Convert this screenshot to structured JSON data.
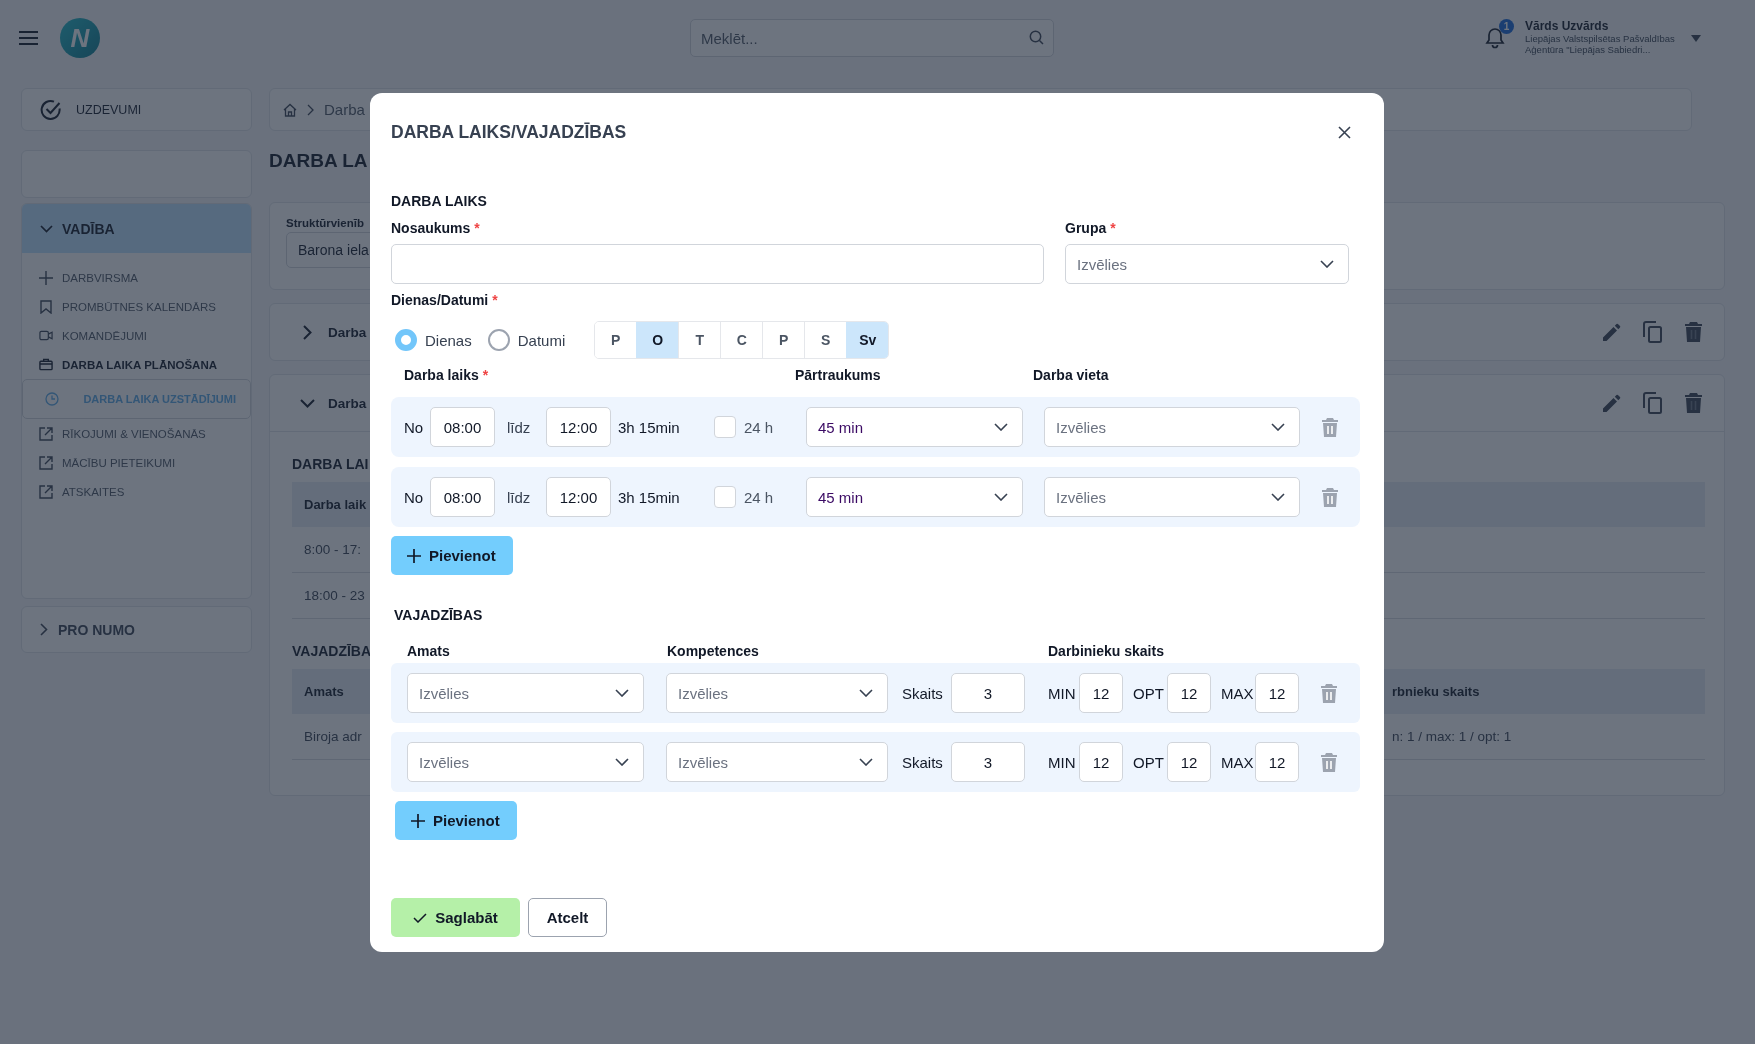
{
  "topbar": {
    "logo": "N",
    "search": {
      "placeholder": "Meklēt..."
    },
    "notifications": {
      "badge": "1"
    },
    "user": {
      "name": "Vārds Uzvārds",
      "org_lines": [
        "Liepājas Valstspilsētas Pašvaldības",
        "Aģentūra \"Liepājas Sabiedri..."
      ]
    }
  },
  "sidebar": {
    "tasks": "UZDEVUMI",
    "section": {
      "title": "VADĪBA",
      "expanded": true,
      "items": [
        {
          "label": "DARBVIRSMA",
          "selected": false,
          "expanded": false
        },
        {
          "label": "PROMBŪTNES KALENDĀRS",
          "selected": false,
          "expanded": false
        },
        {
          "label": "KOMANDĒJUMI",
          "selected": false,
          "expanded": false
        },
        {
          "label": "DARBA LAIKA PLĀNOŠANA",
          "selected": false,
          "expanded": true,
          "children": [
            {
              "label": "DARBA LAIKA UZSTĀDĪJUMI",
              "selected": true
            }
          ]
        },
        {
          "label": "RĪKOJUMI & VIENOŠANĀS",
          "selected": false,
          "expanded": false
        },
        {
          "label": "MĀCĪBU PIETEIKUMI",
          "selected": false,
          "expanded": false
        },
        {
          "label": "ATSKAITES",
          "selected": false,
          "expanded": false
        }
      ]
    },
    "footer_section": {
      "title": "PRO NUMO",
      "expanded": false
    }
  },
  "page": {
    "breadcrumb": "Darba",
    "title": "DARBA LA",
    "filter": {
      "label": "Struktūrvienīb",
      "value": "Barona iela"
    },
    "accordions": [
      {
        "title": "Darba",
        "expanded": false
      },
      {
        "title": "Darba",
        "expanded": true,
        "work_heading": "DARBA LAI",
        "work_column": "Darba laik",
        "work_rows": [
          "8:00 - 17:",
          "18:00 - 23"
        ],
        "needs_heading": "VAJADZĪBA",
        "needs_columns": [
          "Amats",
          "rbnieku skaits"
        ],
        "needs_rows": [
          [
            "Biroja adr",
            "n: 1 / max: 1 / opt: 1"
          ]
        ]
      }
    ]
  },
  "modal": {
    "title": "DARBA LAIKS/VAJADZĪBAS",
    "work_time": {
      "heading": "DARBA LAIKS",
      "name": {
        "label": "Nosaukums",
        "required_mark": "*"
      },
      "group": {
        "label": "Grupa",
        "required_mark": "*",
        "placeholder": "Izvēlies"
      },
      "days_label": {
        "label": "Dienas/Datumi",
        "required_mark": "*"
      },
      "modes": [
        {
          "label": "Dienas",
          "selected": true
        },
        {
          "label": "Datumi",
          "selected": false
        }
      ],
      "days": [
        {
          "label": "P",
          "selected": false
        },
        {
          "label": "O",
          "selected": true
        },
        {
          "label": "T",
          "selected": false
        },
        {
          "label": "C",
          "selected": false
        },
        {
          "label": "P",
          "selected": false
        },
        {
          "label": "S",
          "selected": false
        },
        {
          "label": "Sv",
          "selected": true
        }
      ],
      "columns": [
        {
          "label": "Darba laiks",
          "required_mark": "*"
        },
        {
          "label": "Pārtraukums"
        },
        {
          "label": "Darba vieta"
        }
      ],
      "rows": [
        {
          "from_label": "No",
          "from": "08:00",
          "to_label": "līdz",
          "to": "12:00",
          "duration": "3h 15min",
          "all_day": false,
          "all_day_label": "24 h",
          "break": "45 min",
          "place_placeholder": "Izvēlies"
        },
        {
          "from_label": "No",
          "from": "08:00",
          "to_label": "līdz",
          "to": "12:00",
          "duration": "3h 15min",
          "all_day": false,
          "all_day_label": "24 h",
          "break": "45 min",
          "place_placeholder": "Izvēlies"
        }
      ],
      "add_button": "Pievienot"
    },
    "needs": {
      "heading": "VAJADZĪBAS",
      "columns": [
        "Amats",
        "Kompetences",
        "Darbinieku skaits"
      ],
      "rows": [
        {
          "position_placeholder": "Izvēlies",
          "competence_placeholder": "Izvēlies",
          "count_label": "Skaits",
          "count": "3",
          "min_label": "MIN",
          "min": "12",
          "opt_label": "OPT",
          "opt": "12",
          "max_label": "MAX",
          "max": "12"
        },
        {
          "position_placeholder": "Izvēlies",
          "competence_placeholder": "Izvēlies",
          "count_label": "Skaits",
          "count": "3",
          "min_label": "MIN",
          "min": "12",
          "opt_label": "OPT",
          "opt": "12",
          "max_label": "MAX",
          "max": "12"
        }
      ],
      "add_button": "Pievienot"
    },
    "buttons": {
      "save": "Saglabāt",
      "cancel": "Atcelt"
    }
  }
}
